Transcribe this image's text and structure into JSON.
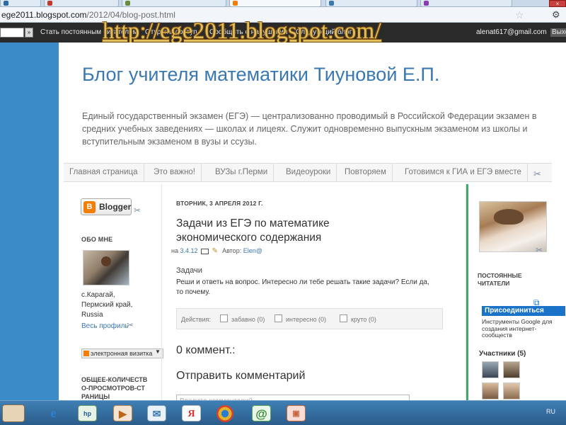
{
  "browser": {
    "address": {
      "host": "ege2011.blogspot.com",
      "path": "/2012/04/blog-post.html"
    },
    "accent_colors": {
      "tab_bg": "#dfe9f4",
      "close": "#c8403b"
    }
  },
  "navbar": {
    "search_button_label": "»",
    "links": [
      "Стать постоянным читателем",
      "Открыть доступ",
      "Сообщить о нарушении",
      "Следующий блог»"
    ],
    "email": "alenat617@gmail.com",
    "logout": "Выход"
  },
  "watermark": "http://ege2011.blogspot.com/",
  "blog": {
    "title": "Блог учителя математики Тиуновой Е.П.",
    "description": "Единый государственный экзамен (ЕГЭ) — централизованно проводимый в Российской Федерации экзамен в средних учебных заведениях — школах и лицеях. Служит одновременно выпускным экзаменом из школы и вступительным экзаменом в вузы и ссузы."
  },
  "tabs": [
    "Главная страница",
    "Это важно!",
    "ВУЗы г.Перми",
    "Видеоуроки",
    "Повторяем",
    "Готовимся к ГИА и ЕГЭ вместе"
  ],
  "left": {
    "blogger_label": "Blogger",
    "about_heading": "ОБО МНЕ",
    "location": [
      "с.Карагай,",
      "Пермский край,",
      "Russia"
    ],
    "profile_link": "Весь профиль",
    "card_widget": "электронная визитка",
    "views_heading": "ОБЩЕЕ-КОЛИЧЕСТВ О-ПРОСМОТРОВ-СТ РАНИЦЫ"
  },
  "post": {
    "date": "ВТОРНИК, 3 АПРЕЛЯ 2012 Г.",
    "title": "Задачи из ЕГЭ по математике экономического содержания",
    "meta_prefix": "на",
    "meta_date": "3.4.12",
    "meta_author_label": "Автор:",
    "meta_author": "Elen@",
    "subheading": "Задачи",
    "body": "Реши и ответь на вопрос. Интересно ли тебе решать такие задачи? Если да, то почему.",
    "actions_label": "Действия:",
    "actions": [
      "забавно (0)",
      "интересно (0)",
      "круто (0)"
    ],
    "comments_count": "0 коммент.:",
    "send_comment": "Отправить комментарий",
    "comment_placeholder": "Введите комментарий..."
  },
  "right": {
    "readers_heading": "ПОСТОЯННЫЕ ЧИТАТЕЛИ",
    "join_button": "Присоединиться",
    "google_tools": "Инструменты Google для создания интернет-сообществ",
    "participants": "Участники (5)"
  },
  "taskbar": {
    "language": "RU",
    "icons": [
      "explorer-icon",
      "internet-explorer-icon",
      "hp-icon",
      "media-player-icon",
      "mail-icon",
      "yandex-icon",
      "chrome-icon",
      "icq-icon",
      "powerpoint-icon"
    ]
  }
}
